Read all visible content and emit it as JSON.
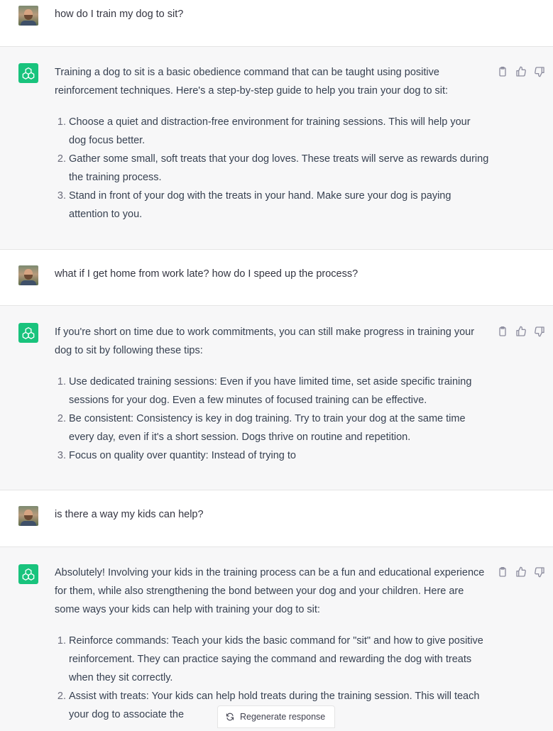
{
  "messages": [
    {
      "role": "user",
      "text": "how do I train my dog to sit?"
    },
    {
      "role": "assistant",
      "intro": "Training a dog to sit is a basic obedience command that can be taught using positive reinforcement techniques. Here's a step-by-step guide to help you train your dog to sit:",
      "items": [
        "Choose a quiet and distraction-free environment for training sessions. This will help your dog focus better.",
        "Gather some small, soft treats that your dog loves. These treats will serve as rewards during the training process.",
        "Stand in front of your dog with the treats in your hand. Make sure your dog is paying attention to you."
      ]
    },
    {
      "role": "user",
      "text": "what if I get home from work late? how do I speed up the process?"
    },
    {
      "role": "assistant",
      "intro": "If you're short on time due to work commitments, you can still make progress in training your dog to sit by following these tips:",
      "items": [
        "Use dedicated training sessions: Even if you have limited time, set aside specific training sessions for your dog. Even a few minutes of focused training can be effective.",
        "Be consistent: Consistency is key in dog training. Try to train your dog at the same time every day, even if it's a short session. Dogs thrive on routine and repetition.",
        "Focus on quality over quantity: Instead of trying to"
      ]
    },
    {
      "role": "user",
      "text": "is there a way my kids can help?"
    },
    {
      "role": "assistant",
      "intro": "Absolutely! Involving your kids in the training process can be a fun and educational experience for them, while also strengthening the bond between your dog and your children. Here are some ways your kids can help with training your dog to sit:",
      "items": [
        "Reinforce commands: Teach your kids the basic command for \"sit\" and how to give positive reinforcement. They can practice saying the command and rewarding the dog with treats when they sit correctly.",
        "Assist with treats: Your kids can help hold treats during the training session. This will teach your dog to associate the"
      ]
    }
  ],
  "regenerate_label": "Regenerate response",
  "icons": {
    "copy": "clipboard-icon",
    "like": "thumbs-up-icon",
    "dislike": "thumbs-down-icon",
    "regenerate": "refresh-icon",
    "assistant": "openai-logo-icon"
  },
  "colors": {
    "assistant_bg": "#f7f7f8",
    "assistant_avatar": "#19c37d"
  }
}
